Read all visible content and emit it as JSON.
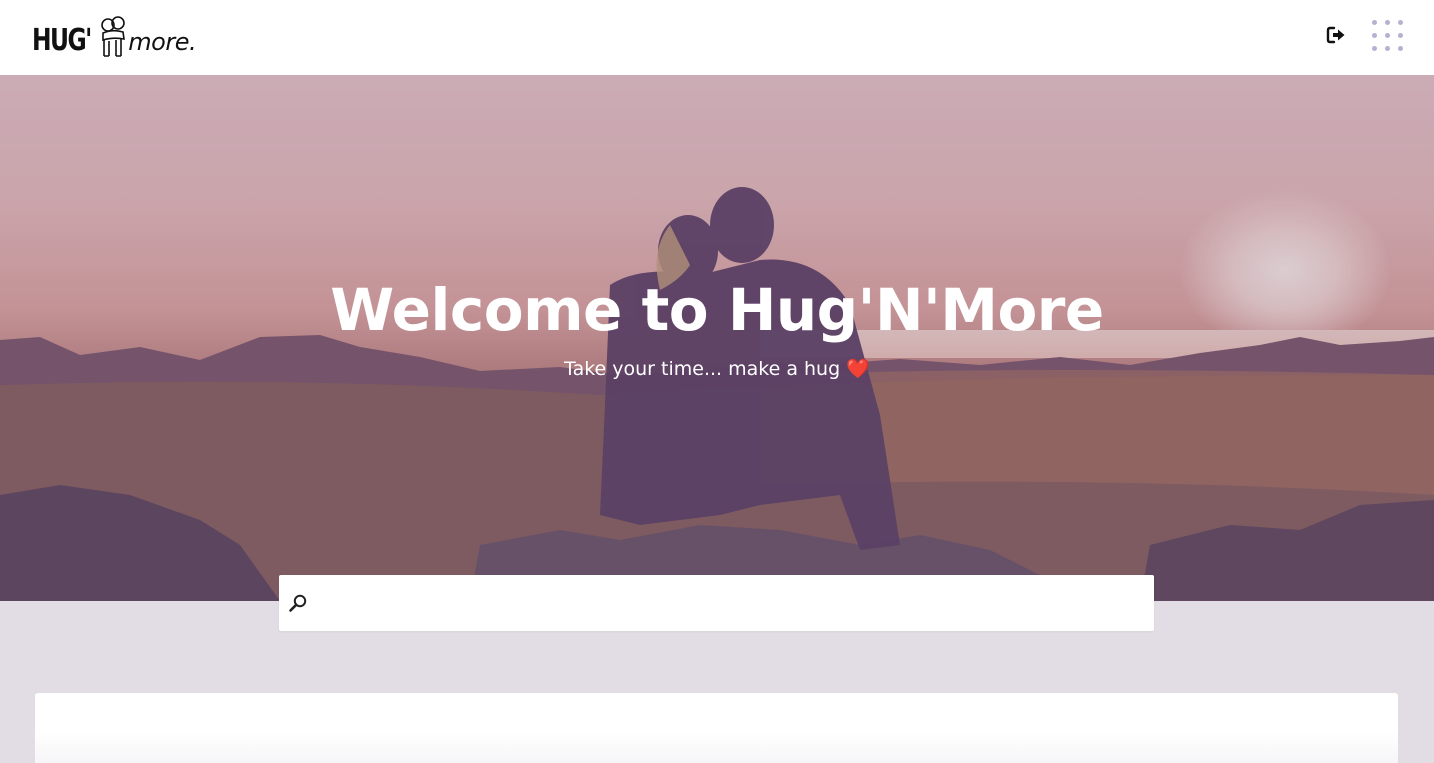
{
  "header": {
    "logo": {
      "brand_word": "HUG'",
      "tagline_word": "more."
    },
    "logout_icon": "logout-icon",
    "apps_icon": "apps-grid-icon"
  },
  "hero": {
    "title": "Welcome to Hug'N'More",
    "subtitle": "Take your time... make a hug",
    "subtitle_emoji": "❤️"
  },
  "search": {
    "icon": "search-icon",
    "value": "",
    "placeholder": ""
  },
  "colors": {
    "header_bg": "#ffffff",
    "page_bg": "#e2dde4",
    "accent_dots": "#b9afd1",
    "heart": "#d83a47"
  }
}
